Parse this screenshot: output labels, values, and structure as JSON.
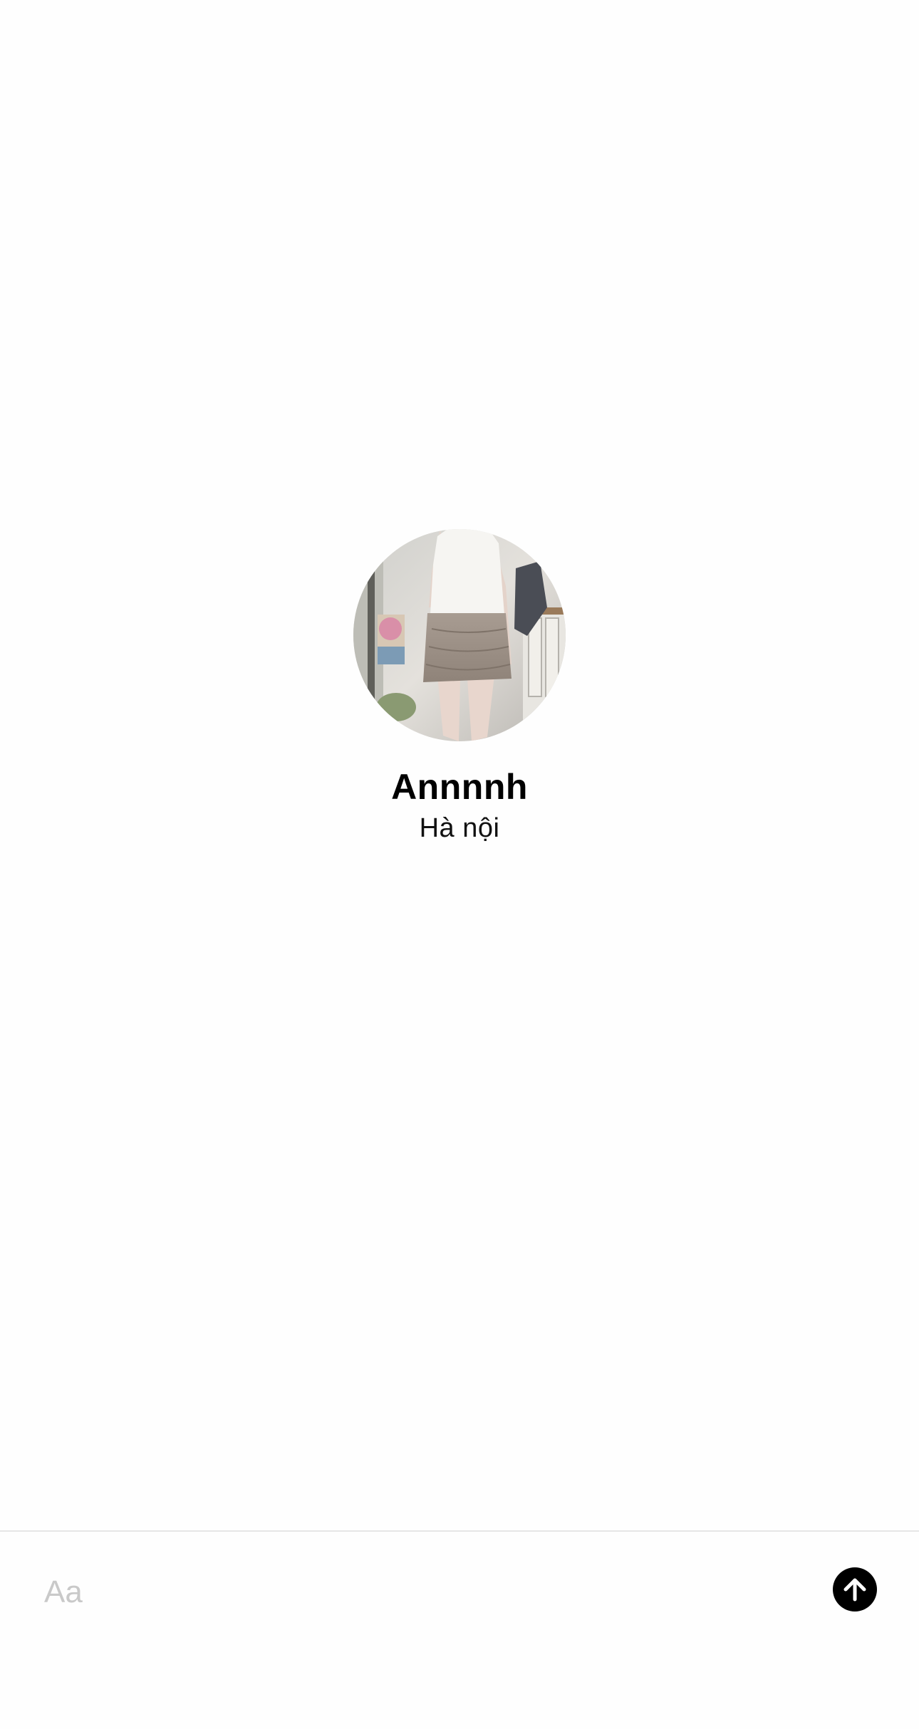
{
  "profile": {
    "name": "Annnnh",
    "location": "Hà nội",
    "avatar_icon": "profile-photo"
  },
  "composer": {
    "placeholder": "Aa",
    "value": "",
    "send_icon": "arrow-up-icon",
    "send_color": "#000000"
  }
}
